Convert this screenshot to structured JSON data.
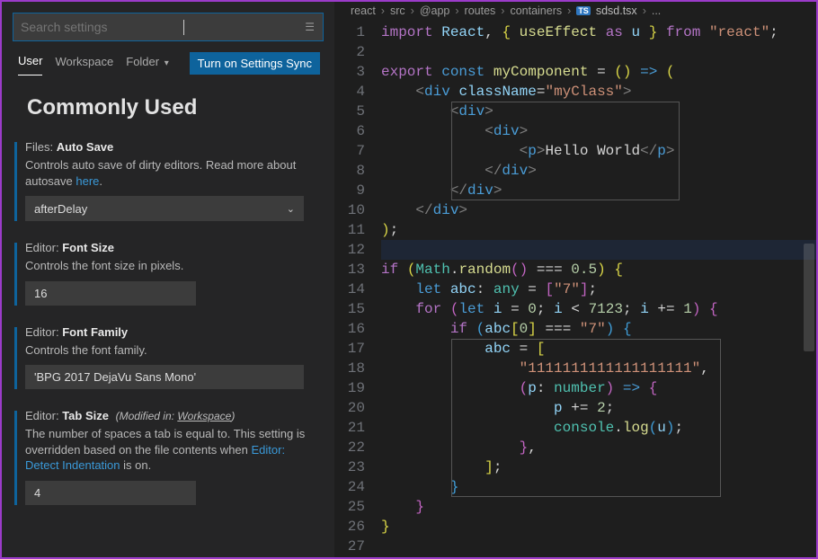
{
  "search": {
    "placeholder": "Search settings"
  },
  "tabs": {
    "user": "User",
    "workspace": "Workspace",
    "folder": "Folder"
  },
  "syncButton": "Turn on Settings Sync",
  "sectionTitle": "Commonly Used",
  "settings": {
    "autosave": {
      "category": "Files:",
      "key": "Auto Save",
      "desc1": "Controls auto save of dirty editors. Read more about autosave ",
      "link": "here",
      "desc2": ".",
      "value": "afterDelay"
    },
    "fontsize": {
      "category": "Editor:",
      "key": "Font Size",
      "desc": "Controls the font size in pixels.",
      "value": "16"
    },
    "fontfamily": {
      "category": "Editor:",
      "key": "Font Family",
      "desc": "Controls the font family.",
      "value": "'BPG 2017 DejaVu Sans Mono'"
    },
    "tabsize": {
      "category": "Editor:",
      "key": "Tab Size",
      "modPrefix": "(Modified in: ",
      "modScope": "Workspace",
      "modSuffix": ")",
      "desc1": "The number of spaces a tab is equal to. This setting is overridden based on the file contents when ",
      "link": "Editor: Detect Indentation",
      "desc2": " is on.",
      "value": "4"
    }
  },
  "breadcrumb": {
    "parts": [
      "react",
      "src",
      "@app",
      "routes",
      "containers"
    ],
    "icon": "TS",
    "file": "sdsd.tsx",
    "tail": "..."
  },
  "code": {
    "lineCount": 27,
    "l1_import": "import",
    "l1_react": "React",
    "l1_useEffect": "useEffect",
    "l1_as": "as",
    "l1_u": "u",
    "l1_from": "from",
    "l1_reactstr": "\"react\"",
    "l3_export": "export",
    "l3_const": "const",
    "l3_name": "myComponent",
    "l4_div": "div",
    "l4_attr": "className",
    "l4_val": "\"myClass\"",
    "l5_div": "div",
    "l6_div": "div",
    "l7_p": "p",
    "l7_text": "Hello World",
    "l8_div": "div",
    "l9_div": "div",
    "l10_div": "div",
    "l13_if": "if",
    "l13_math": "Math",
    "l13_random": "random",
    "l13_num": "0.5",
    "l14_let": "let",
    "l14_abc": "abc",
    "l14_any": "any",
    "l14_seven": "\"7\"",
    "l15_for": "for",
    "l15_let": "let",
    "l15_i": "i",
    "l15_zero": "0",
    "l15_limit": "7123",
    "l15_one": "1",
    "l16_if": "if",
    "l16_abc": "abc",
    "l16_zero": "0",
    "l16_seven": "\"7\"",
    "l17_abc": "abc",
    "l18_str": "\"1111111111111111111\"",
    "l19_p": "p",
    "l19_number": "number",
    "l20_p": "p",
    "l20_two": "2",
    "l21_console": "console",
    "l21_log": "log",
    "l21_u": "u"
  }
}
